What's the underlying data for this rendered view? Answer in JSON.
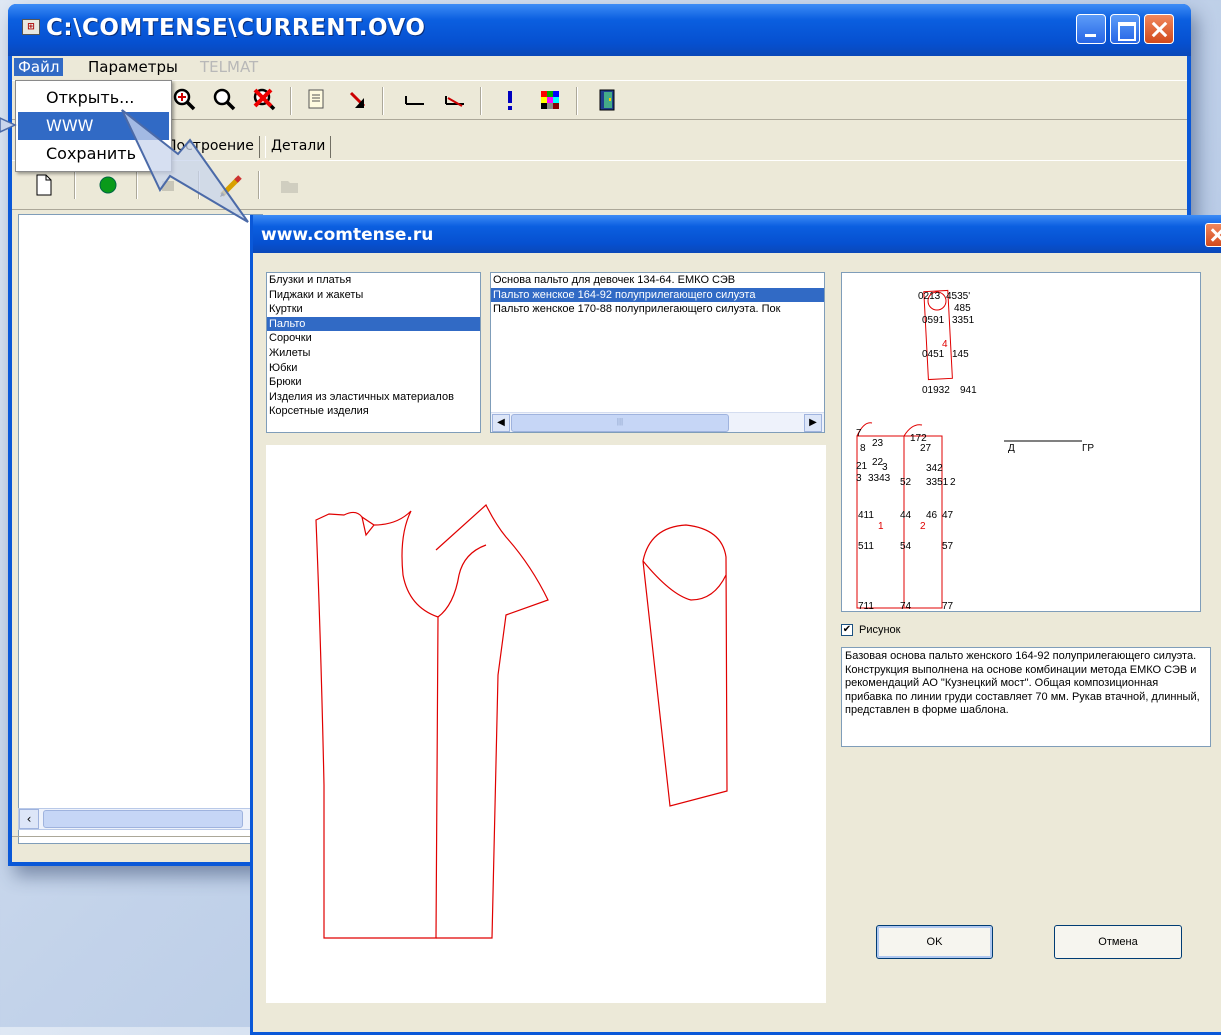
{
  "main_window": {
    "title": "C:\\COMTENSE\\CURRENT.OVO",
    "menu": {
      "file": "Файл",
      "params": "Параметры",
      "telmat": "TELMAT"
    },
    "tabs": [
      "Построение",
      "Детали"
    ]
  },
  "file_menu": {
    "items": [
      "Открыть...",
      "WWW",
      "Сохранить"
    ],
    "highlighted_index": 1
  },
  "dialog": {
    "title": "www.comtense.ru",
    "categories": [
      "Блузки и платья",
      "Пиджаки и жакеты",
      "Куртки",
      "Пальто",
      "Сорочки",
      "Жилеты",
      "Юбки",
      "Брюки",
      "Изделия из эластичных материалов",
      "Корсетные изделия"
    ],
    "selected_category_index": 3,
    "models": [
      "Основа пальто для девочек 134-64. ЕМКО СЭВ",
      "Пальто женское 164-92 полуприлегающего силуэта",
      "Пальто женское 170-88 полуприлегающего силуэта. Пок"
    ],
    "selected_model_index": 1,
    "preview_labels": {
      "top_piece": [
        "0213",
        "4535'",
        "485",
        "3351",
        "0591",
        "0451",
        "145",
        "01932",
        "941"
      ],
      "piece_numbers": [
        "1",
        "2",
        "4"
      ],
      "body_labels": [
        "172",
        "23",
        "27",
        "8",
        "22",
        "3",
        "342",
        "3",
        "2",
        "3343",
        "52",
        "3351",
        "2",
        "411",
        "44",
        "46",
        "47",
        "511",
        "54",
        "57",
        "711",
        "74",
        "77"
      ],
      "axis_labels": [
        "Д",
        "ГР"
      ]
    },
    "show_picture_label": "Рисунок",
    "show_picture_checked": true,
    "description": "Базовая основа пальто женского 164-92 полуприлегающего силуэта. Конструкция выполнена на основе комбинации метода ЕМКО СЭВ и рекомендаций АО \"Кузнецкий мост\". Общая композиционная прибавка по линии груди составляет 70 мм. Рукав втачной, длинный, представлен в форме шаблона.",
    "ok_label": "OK",
    "cancel_label": "Отмена"
  },
  "colors": {
    "xp_blue": "#0a58d8",
    "selection": "#316ac5",
    "pattern_red": "#e00000",
    "window_face": "#ece9d8"
  }
}
